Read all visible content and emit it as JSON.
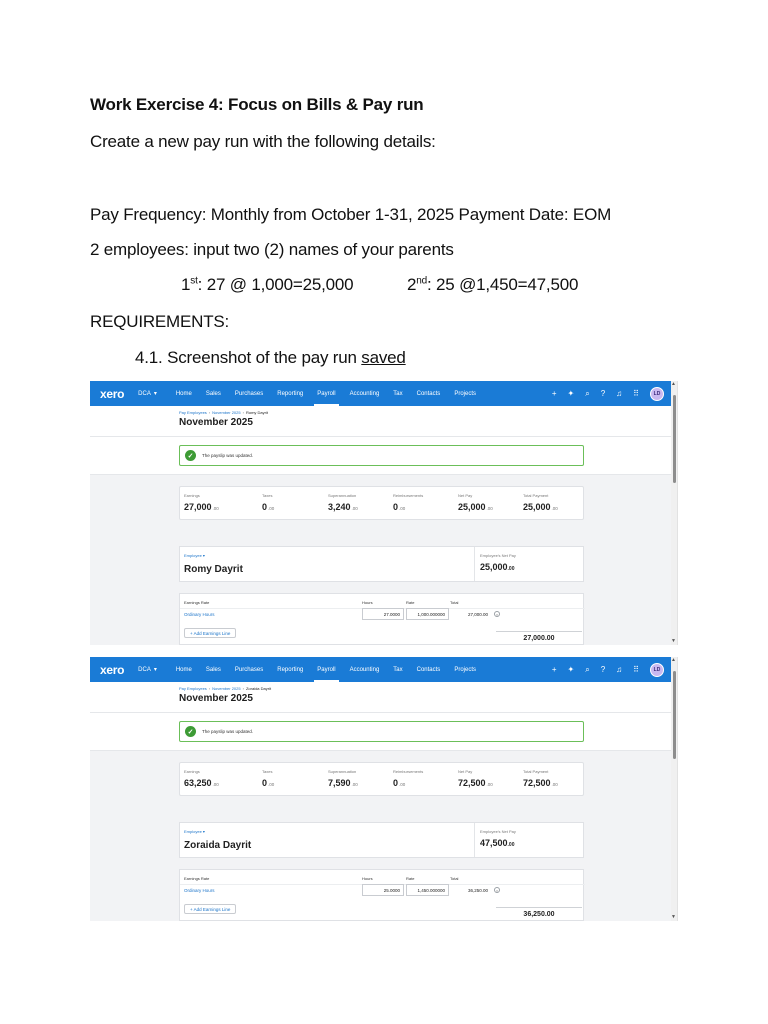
{
  "document": {
    "title": "Work Exercise 4: Focus on Bills & Pay run",
    "intro": "Create a new pay run with the following details:",
    "frequency_line": "Pay Frequency: Monthly from October 1-31, 2025 Payment Date: EOM",
    "employees_line": "2 employees: input two (2) names of your parents",
    "emp1_ord": "1",
    "emp1_sup": "st",
    "emp1_calc": ": 27 @ 1,000=25,000",
    "emp2_ord": "2",
    "emp2_sup": "nd",
    "emp2_calc": ": 25 @1,450=47,500",
    "requirements": "REQUIREMENTS:",
    "req_item_prefix": "4.1. Screenshot of the pay run ",
    "req_item_underlined": "saved"
  },
  "app": {
    "logo": "xero",
    "org": "DCA",
    "nav": [
      "Home",
      "Sales",
      "Purchases",
      "Reporting",
      "Payroll",
      "Accounting",
      "Tax",
      "Contacts",
      "Projects"
    ],
    "active_nav": "Payroll",
    "avatar": "LD",
    "crumb_1": "Pay Employees",
    "crumb_2": "November 2025",
    "page_title": "November 2025",
    "alert": "The payslip was updated.",
    "labels": {
      "earnings": "Earnings",
      "taxes": "Taxes",
      "superannuation": "Superannuation",
      "reimbursements": "Reimbursements",
      "net_pay": "Net Pay",
      "total_payment": "Total Payment",
      "employee": "Employee ▾",
      "employee_net_pay": "Employee's Net Pay",
      "earnings_rate": "Earnings Rate",
      "hours": "Hours",
      "rate": "Rate",
      "total": "Total",
      "ordinary_hours": "Ordinary Hours",
      "add_earnings_line": "+ Add Earnings Line",
      "cents": ".00"
    }
  },
  "screens": [
    {
      "crumb_name": "Romy Dayrit",
      "earnings": "27,000",
      "taxes": "0",
      "super": "3,240",
      "reimb": "0",
      "net_pay": "25,000",
      "total_payment": "25,000",
      "employee_name": "Romy Dayrit",
      "employee_net": "25,000",
      "hours_label": "Hours",
      "hours": "27.0000",
      "rate": "1,000.000000",
      "line_total": "27,000.00",
      "earnings_total": "27,000.00"
    },
    {
      "crumb_name": "Zoraida Dayrit",
      "earnings": "63,250",
      "taxes": "0",
      "super": "7,590",
      "reimb": "0",
      "net_pay": "72,500",
      "total_payment": "72,500",
      "employee_name": "Zoraida Dayrit",
      "employee_net": "47,500",
      "hours_label": "Hours",
      "hours": "25.0000",
      "rate": "1,450.000000",
      "line_total": "36,250.00",
      "earnings_total": "36,250.00"
    }
  ],
  "colors": {
    "nav_blue": "#1a7bd6",
    "success_green": "#3d9b35",
    "link_blue": "#1a73c9"
  }
}
